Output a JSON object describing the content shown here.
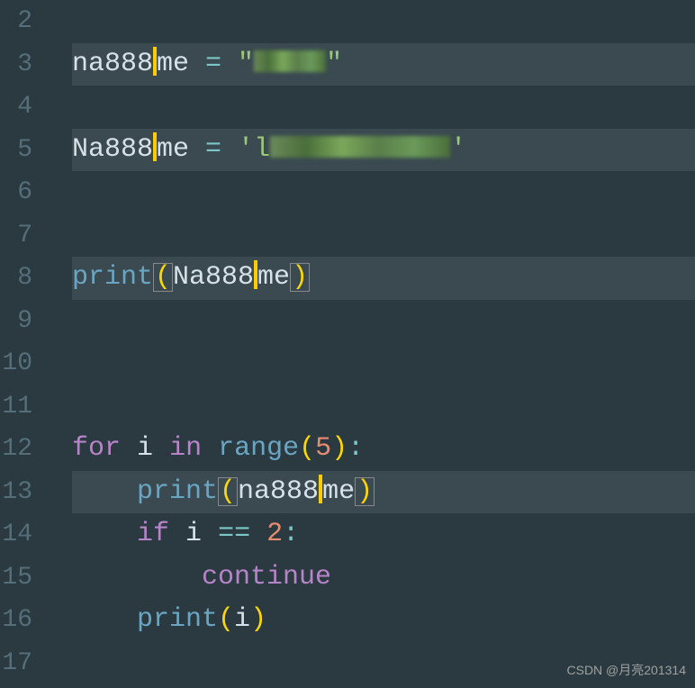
{
  "lineNumbers": [
    "2",
    "3",
    "4",
    "5",
    "6",
    "7",
    "8",
    "9",
    "10",
    "11",
    "12",
    "13",
    "14",
    "15",
    "16",
    "17"
  ],
  "code": {
    "line3": {
      "var1": "na888",
      "var2": "me",
      "assign": " = ",
      "quote1": "\"",
      "quote2": "\""
    },
    "line5": {
      "var1": "Na888",
      "var2": "me",
      "assign": " = ",
      "quote1": "'",
      "str_prefix": "l",
      "quote2": "'"
    },
    "line8": {
      "fn": "print",
      "lparen": "(",
      "var1": "Na888",
      "var2": "me",
      "rparen": ")"
    },
    "line12": {
      "for": "for",
      "sp1": " ",
      "i": "i",
      "sp2": " ",
      "in": "in",
      "sp3": " ",
      "range": "range",
      "lparen": "(",
      "num": "5",
      "rparen": ")",
      "colon": ":"
    },
    "line13": {
      "indent": "    ",
      "fn": "print",
      "lparen": "(",
      "var1": "na888",
      "var2": "me",
      "rparen": ")"
    },
    "line14": {
      "indent": "    ",
      "if": "if",
      "sp1": " ",
      "i": "i",
      "sp2": " ",
      "eq": "==",
      "sp3": " ",
      "num": "2",
      "colon": ":"
    },
    "line15": {
      "indent": "        ",
      "continue": "continue"
    },
    "line16": {
      "indent": "    ",
      "fn": "print",
      "lparen": "(",
      "i": "i",
      "rparen": ")"
    }
  },
  "watermark": "CSDN @月亮201314"
}
